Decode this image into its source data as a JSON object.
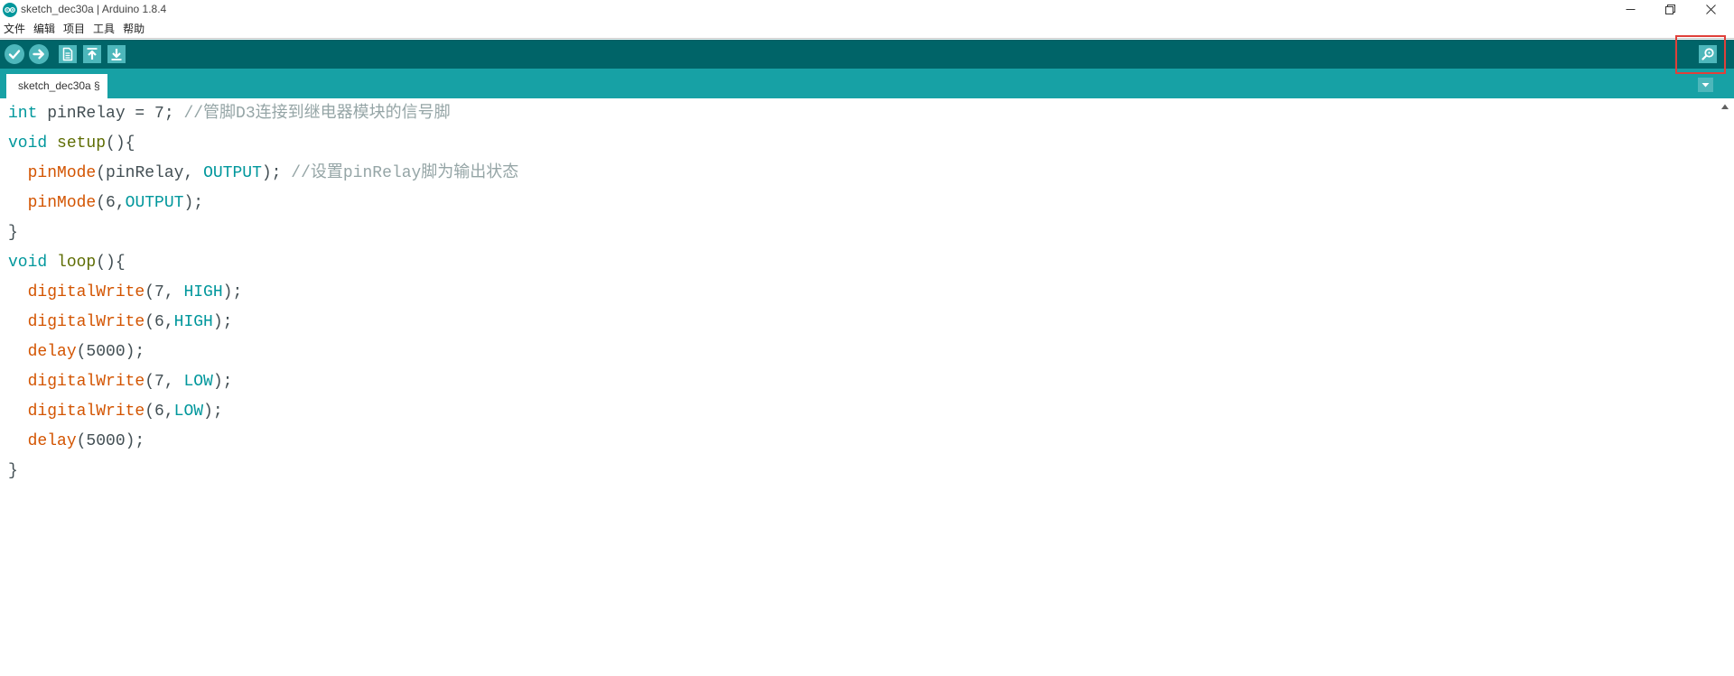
{
  "window": {
    "title": "sketch_dec30a | Arduino 1.8.4",
    "logo_icon": "arduino-logo-icon",
    "controls": {
      "minimize_icon": "minimize-icon",
      "restore_icon": "restore-icon",
      "close_icon": "close-icon"
    }
  },
  "menu": {
    "items": [
      "文件",
      "编辑",
      "项目",
      "工具",
      "帮助"
    ]
  },
  "toolbar": {
    "buttons": [
      {
        "icon": "verify-check-icon"
      },
      {
        "icon": "upload-arrow-icon"
      },
      {
        "icon": "new-sketch-icon"
      },
      {
        "icon": "open-sketch-icon"
      },
      {
        "icon": "save-sketch-icon"
      }
    ],
    "serial_monitor": {
      "icon": "serial-monitor-icon",
      "highlighted": true
    }
  },
  "tabs": [
    {
      "label": "sketch_dec30a §",
      "active": true
    }
  ],
  "tab_menu_icon": "tab-dropdown-icon",
  "scrollbar": {
    "up_icon": "scroll-up-arrow-icon"
  },
  "colors": {
    "toolbar_bg": "#006468",
    "tabbar_bg": "#17A1A5",
    "button_bg": "#4DB7BB",
    "highlight": "#E0403A",
    "keyword": "#00979C",
    "function_name": "#5E6D03",
    "builtin": "#D35400",
    "comment": "#95A5A6",
    "text": "#434F54"
  },
  "editor": {
    "lines": [
      {
        "tokens": [
          {
            "text": "int",
            "color": "#00979C"
          },
          {
            "text": " pinRelay = 7; ",
            "color": "#434F54"
          },
          {
            "text": "//管脚D3连接到继电器模块的信号脚",
            "color": "#95A5A6"
          }
        ]
      },
      {
        "tokens": [
          {
            "text": "void",
            "color": "#00979C"
          },
          {
            "text": " ",
            "color": "#434F54"
          },
          {
            "text": "setup",
            "color": "#5E6D03"
          },
          {
            "text": "(){",
            "color": "#434F54"
          }
        ]
      },
      {
        "tokens": [
          {
            "text": "  ",
            "color": "#434F54"
          },
          {
            "text": "pinMode",
            "color": "#D35400"
          },
          {
            "text": "(pinRelay, ",
            "color": "#434F54"
          },
          {
            "text": "OUTPUT",
            "color": "#00979C"
          },
          {
            "text": "); ",
            "color": "#434F54"
          },
          {
            "text": "//设置pinRelay脚为输出状态",
            "color": "#95A5A6"
          }
        ]
      },
      {
        "tokens": [
          {
            "text": "  ",
            "color": "#434F54"
          },
          {
            "text": "pinMode",
            "color": "#D35400"
          },
          {
            "text": "(6,",
            "color": "#434F54"
          },
          {
            "text": "OUTPUT",
            "color": "#00979C"
          },
          {
            "text": ");",
            "color": "#434F54"
          }
        ]
      },
      {
        "tokens": [
          {
            "text": "}",
            "color": "#434F54"
          }
        ]
      },
      {
        "tokens": [
          {
            "text": "void",
            "color": "#00979C"
          },
          {
            "text": " ",
            "color": "#434F54"
          },
          {
            "text": "loop",
            "color": "#5E6D03"
          },
          {
            "text": "(){",
            "color": "#434F54"
          }
        ]
      },
      {
        "tokens": [
          {
            "text": "  ",
            "color": "#434F54"
          },
          {
            "text": "digitalWrite",
            "color": "#D35400"
          },
          {
            "text": "(7, ",
            "color": "#434F54"
          },
          {
            "text": "HIGH",
            "color": "#00979C"
          },
          {
            "text": ");",
            "color": "#434F54"
          }
        ]
      },
      {
        "tokens": [
          {
            "text": "  ",
            "color": "#434F54"
          },
          {
            "text": "digitalWrite",
            "color": "#D35400"
          },
          {
            "text": "(6,",
            "color": "#434F54"
          },
          {
            "text": "HIGH",
            "color": "#00979C"
          },
          {
            "text": ");",
            "color": "#434F54"
          }
        ]
      },
      {
        "tokens": [
          {
            "text": "  ",
            "color": "#434F54"
          },
          {
            "text": "delay",
            "color": "#D35400"
          },
          {
            "text": "(5000);",
            "color": "#434F54"
          }
        ]
      },
      {
        "tokens": [
          {
            "text": "  ",
            "color": "#434F54"
          },
          {
            "text": "digitalWrite",
            "color": "#D35400"
          },
          {
            "text": "(7, ",
            "color": "#434F54"
          },
          {
            "text": "LOW",
            "color": "#00979C"
          },
          {
            "text": ");",
            "color": "#434F54"
          }
        ]
      },
      {
        "tokens": [
          {
            "text": "  ",
            "color": "#434F54"
          },
          {
            "text": "digitalWrite",
            "color": "#D35400"
          },
          {
            "text": "(6,",
            "color": "#434F54"
          },
          {
            "text": "LOW",
            "color": "#00979C"
          },
          {
            "text": ");",
            "color": "#434F54"
          }
        ]
      },
      {
        "tokens": [
          {
            "text": "  ",
            "color": "#434F54"
          },
          {
            "text": "delay",
            "color": "#D35400"
          },
          {
            "text": "(5000);",
            "color": "#434F54"
          }
        ]
      },
      {
        "tokens": [
          {
            "text": "}",
            "color": "#434F54"
          }
        ]
      }
    ]
  }
}
